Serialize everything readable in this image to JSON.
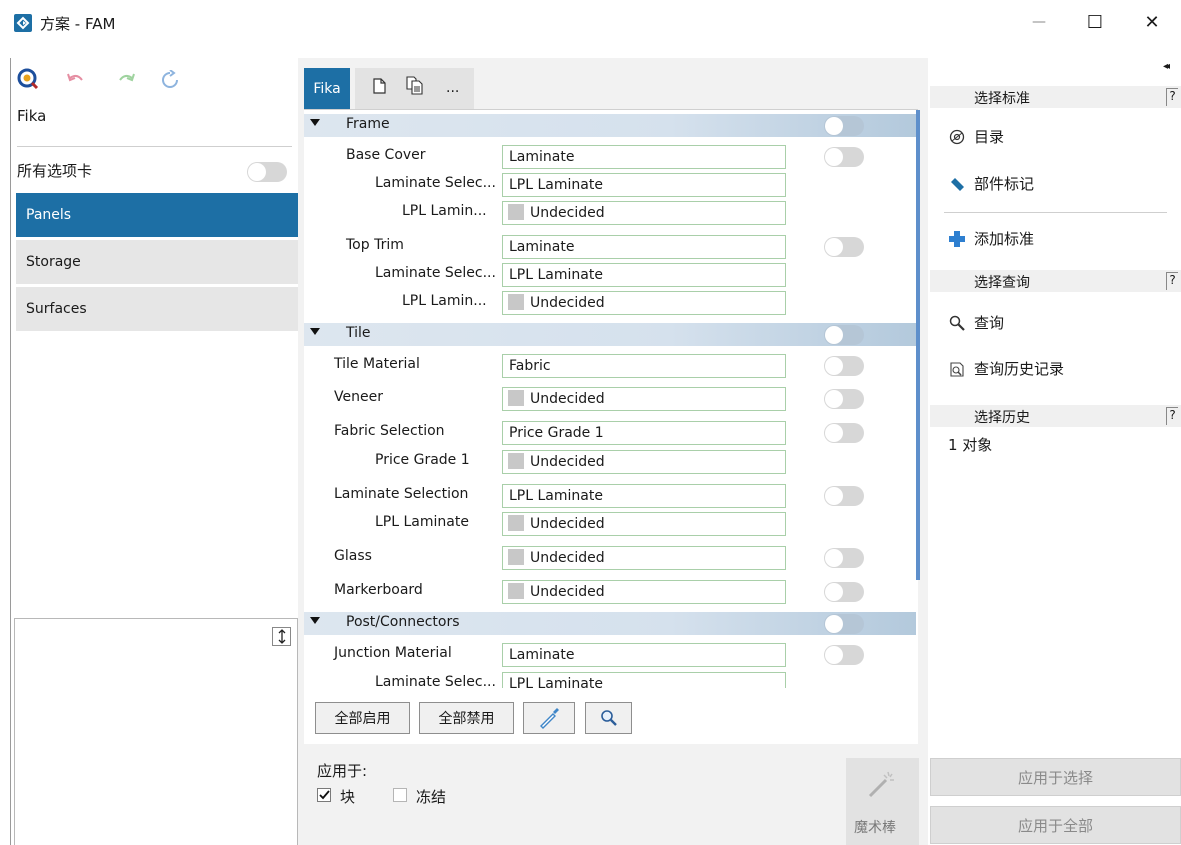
{
  "window": {
    "title": "方案 - FAM",
    "minimize_glyph": "—",
    "maximize_glyph": "☐",
    "close_glyph": "✕"
  },
  "left": {
    "scheme_name": "Fika",
    "all_tabs_label": "所有选项卡",
    "categories": [
      "Panels",
      "Storage",
      "Surfaces"
    ],
    "selected_category": "Panels"
  },
  "tabs": {
    "active": "Fika",
    "more": "..."
  },
  "sections": [
    {
      "title": "Frame",
      "rows": [
        {
          "label": "Base Cover",
          "value": "Laminate",
          "swatch": false
        },
        {
          "label": "Laminate Selec...",
          "value": "LPL Laminate",
          "swatch": false
        },
        {
          "label": "LPL Lamin...",
          "value": "Undecided",
          "swatch": true
        },
        {
          "label": "Top Trim",
          "value": "Laminate",
          "swatch": false
        },
        {
          "label": "Laminate Selec...",
          "value": "LPL Laminate",
          "swatch": false
        },
        {
          "label": "LPL Lamin...",
          "value": "Undecided",
          "swatch": true
        }
      ]
    },
    {
      "title": "Tile",
      "rows": [
        {
          "label": "Tile Material",
          "value": "Fabric",
          "swatch": false
        },
        {
          "label": "Veneer",
          "value": "Undecided",
          "swatch": true
        },
        {
          "label": "Fabric Selection",
          "value": "Price Grade 1",
          "swatch": false
        },
        {
          "label": "Price Grade 1",
          "value": "Undecided",
          "swatch": true
        },
        {
          "label": "Laminate Selection",
          "value": "LPL Laminate",
          "swatch": false
        },
        {
          "label": "LPL Laminate",
          "value": "Undecided",
          "swatch": true
        },
        {
          "label": "Glass",
          "value": "Undecided",
          "swatch": true
        },
        {
          "label": "Markerboard",
          "value": "Undecided",
          "swatch": true
        }
      ]
    },
    {
      "title": "Post/Connectors",
      "rows": [
        {
          "label": "Junction Material",
          "value": "Laminate",
          "swatch": false
        },
        {
          "label": "Laminate Selec...",
          "value": "LPL Laminate",
          "swatch": false
        }
      ]
    }
  ],
  "bottom_buttons": {
    "enable_all": "全部启用",
    "disable_all": "全部禁用"
  },
  "apply_to": {
    "label": "应用于:",
    "block_label": "块",
    "block_checked": true,
    "freeze_label": "冻结",
    "freeze_checked": false
  },
  "magic_wand": {
    "label": "魔术棒"
  },
  "right": {
    "select_criteria_header": "选择标准",
    "catalog": "目录",
    "part_tag": "部件标记",
    "add_criteria": "添加标准",
    "select_query_header": "选择查询",
    "query": "查询",
    "query_history": "查询历史记录",
    "select_history_header": "选择历史",
    "object_count": "1 对象",
    "help_glyph": "?",
    "collapse_glyph": "◂◂",
    "apply_selection": "应用于选择",
    "apply_all": "应用于全部"
  },
  "colors": {
    "accent": "#1d6fa5",
    "section_band": "#d5e1ed",
    "field_border": "#a9cfa9",
    "add_icon": "#2e7fd0",
    "tag_icon": "#1d6fa5"
  },
  "icons": [
    "app-logo-icon",
    "query-logo-icon",
    "undo-icon",
    "redo-icon",
    "refresh-icon",
    "new-page-icon",
    "copy-page-icon",
    "eyedropper-icon",
    "search-icon",
    "resize-icon",
    "catalog-icon",
    "tag-icon",
    "add-icon",
    "magnifier-icon",
    "history-icon",
    "magic-wand-icon"
  ]
}
